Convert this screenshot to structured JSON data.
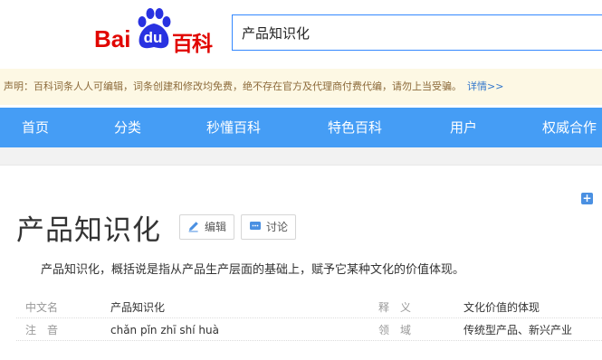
{
  "header": {
    "logo_bai": "Bai",
    "logo_du": "du",
    "logo_baike": "百科",
    "search_value": "产品知识化"
  },
  "notice": {
    "text": "声明：百科词条人人可编辑，词条创建和修改均免费，绝不存在官方及代理商付费代编，请勿上当受骗。",
    "more": "详情>>"
  },
  "nav": {
    "items": [
      {
        "label": "首页"
      },
      {
        "label": "分类"
      },
      {
        "label": "秒懂百科"
      },
      {
        "label": "特色百科"
      },
      {
        "label": "用户"
      },
      {
        "label": "权威合作"
      }
    ]
  },
  "entry": {
    "title": "产品知识化",
    "edit_label": "编辑",
    "discuss_label": "讨论",
    "summary": "产品知识化，概括说是指从产品生产层面的基础上，赋予它某种文化的价值体现。"
  },
  "basic_info": [
    {
      "k1": "中文名",
      "v1": "产品知识化",
      "k2": "释　义",
      "v2": "文化价值的体现"
    },
    {
      "k1": "注　音",
      "v1": "chǎn pǐn zhī shí huà",
      "k2": "领　域",
      "v2": "传统型产品、新兴产业"
    }
  ],
  "colors": {
    "nav_bg": "#459df5",
    "logo_red": "#e10601",
    "logo_blue": "#2932e1",
    "notice_bg": "#fdf8e4"
  }
}
